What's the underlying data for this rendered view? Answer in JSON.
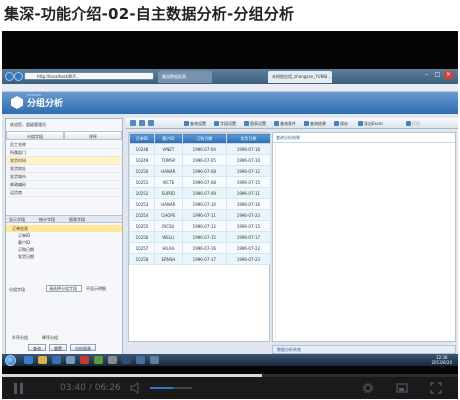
{
  "page": {
    "title": "集深-功能介绍-02-自主数据分析-分组分析"
  },
  "browser": {
    "url": "http://localhost/BI/f...",
    "tabs": [
      "集深数据报表",
      "未授权应用_zhangsan_YUNSI..."
    ],
    "window_buttons": [
      "–",
      "□",
      "×"
    ]
  },
  "app": {
    "logo_sub": "JISHEN BI",
    "logo_title": "分组分析",
    "left": {
      "user": "欢迎您，超级管理员",
      "tabs": [
        "分组字段",
        "排序"
      ],
      "items": [
        "员工名称",
        "所属部门",
        "发货时间",
        "发货地址",
        "发货城市",
        "邮政编码",
        "运货商"
      ],
      "selected_index": 2,
      "tree_header": [
        "显示字段",
        "统计字段",
        "图表字段"
      ],
      "tree": [
        "订单信息",
        "订单ID",
        "客户ID",
        "订购日期",
        "发货日期"
      ],
      "tree_selected_index": 0,
      "field_label": "分组字段",
      "field_select": "请选择分组字段",
      "check_label": "不显示明细",
      "radios": [
        "升序分组",
        "降序分组"
      ],
      "buttons": [
        "查询",
        "重置",
        "分析图表"
      ]
    },
    "toolbar": [
      "查询设置",
      "字段设置",
      "图表设置",
      "查询条件",
      "查询结果",
      "保存",
      "导出Excel",
      "打印"
    ],
    "grid": {
      "headers": [
        "订单ID",
        "客户ID",
        "订购日期",
        "发货日期"
      ],
      "rows": [
        [
          "10248",
          "VINET",
          "1996-07-04",
          "1996-07-16"
        ],
        [
          "10249",
          "TOMSP",
          "1996-07-05",
          "1996-07-10"
        ],
        [
          "10250",
          "HANAR",
          "1996-07-08",
          "1996-07-12"
        ],
        [
          "10251",
          "VICTE",
          "1996-07-08",
          "1996-07-15"
        ],
        [
          "10252",
          "SUPRD",
          "1996-07-09",
          "1996-07-11"
        ],
        [
          "10253",
          "HANAR",
          "1996-07-10",
          "1996-07-16"
        ],
        [
          "10254",
          "CHOPS",
          "1996-07-11",
          "1996-07-23"
        ],
        [
          "10255",
          "RICSU",
          "1996-07-12",
          "1996-07-15"
        ],
        [
          "10256",
          "WELLI",
          "1996-07-15",
          "1996-07-17"
        ],
        [
          "10257",
          "HILAA",
          "1996-07-16",
          "1996-07-22"
        ],
        [
          "10258",
          "ERNSH",
          "1996-07-17",
          "1996-07-23"
        ]
      ]
    },
    "right_title": "查询分析结果",
    "footer": "数据分析系统"
  },
  "taskbar": {
    "clock_time": "12:36",
    "clock_date": "2013/6/20"
  },
  "player": {
    "current": "03:40",
    "total": "06:26",
    "progress": 0.57,
    "volume": 0.55
  }
}
